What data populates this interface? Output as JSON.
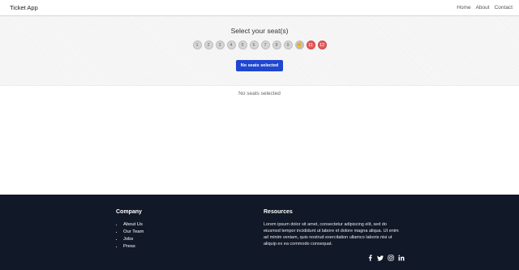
{
  "navbar": {
    "brand": "Ticket App",
    "links": [
      "Home",
      "About",
      "Contact"
    ]
  },
  "hero": {
    "title": "Select your seat(s)",
    "seats": [
      {
        "label": "1",
        "state": "available"
      },
      {
        "label": "2",
        "state": "available"
      },
      {
        "label": "3",
        "state": "available"
      },
      {
        "label": "4",
        "state": "available"
      },
      {
        "label": "5",
        "state": "available"
      },
      {
        "label": "6",
        "state": "available"
      },
      {
        "label": "7",
        "state": "available"
      },
      {
        "label": "8",
        "state": "available"
      },
      {
        "label": "9",
        "state": "available"
      },
      {
        "label": "10",
        "state": "hover"
      },
      {
        "label": "11",
        "state": "booked"
      },
      {
        "label": "12",
        "state": "booked"
      }
    ],
    "button_label": "No seats selected"
  },
  "status": "No seats selected",
  "footer": {
    "company_title": "Company",
    "company_links": [
      "About Us",
      "Our Team",
      "Jobs",
      "Press"
    ],
    "resources_title": "Resources",
    "resources_text": "Lorem ipsum dolor sit amet, consectetur adipiscing elit, sed do eiusmod tempor incididunt ut labore et dolore magna aliqua. Ut enim ad minim veniam, quis nostrud exercitation ullamco laboris nisi ut aliquip ex ea commodo consequat.",
    "social_icons": [
      "facebook-icon",
      "twitter-icon",
      "instagram-icon",
      "linkedin-icon"
    ]
  },
  "colors": {
    "primary": "#1f46d1",
    "booked": "#e35a5a",
    "footer_bg": "#111827"
  }
}
